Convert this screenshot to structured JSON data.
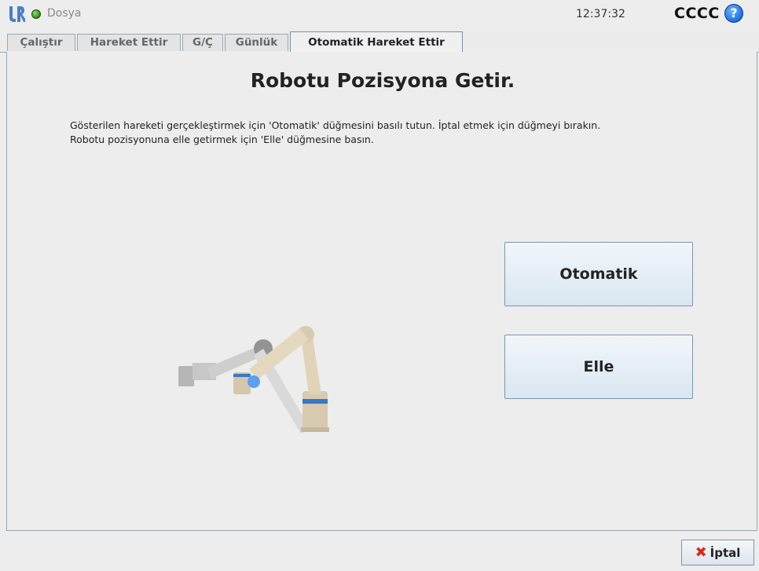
{
  "topbar": {
    "logo": "ur-logo",
    "status": "running-green",
    "file_menu": "Dosya",
    "clock": "12:37:32",
    "robot_name": "CCCC",
    "help_icon": "question-mark-icon",
    "help_label": "?"
  },
  "tabs": [
    {
      "label": "Çalıştır",
      "active": false
    },
    {
      "label": "Hareket Ettir",
      "active": false
    },
    {
      "label": "G/Ç",
      "active": false
    },
    {
      "label": "Günlük",
      "active": false
    },
    {
      "label": "Otomatik Hareket Ettir",
      "active": true
    }
  ],
  "main": {
    "title": "Robotu Pozisyona Getir.",
    "instruction_1": "Gösterilen hareketi gerçekleştirmek için 'Otomatik' düğmesini basılı tutun. İptal etmek için düğmeyi bırakın.",
    "instruction_2": "Robotu pozisyonuna elle getirmek için 'Elle' düğmesine basın.",
    "auto_button": "Otomatik",
    "manual_button": "Elle"
  },
  "footer": {
    "cancel_button": "İptal",
    "cancel_icon": "red-x-icon"
  },
  "colors": {
    "accent_blue": "#4a90d9",
    "status_green": "#2f8a16",
    "cancel_red": "#d62b1e"
  }
}
